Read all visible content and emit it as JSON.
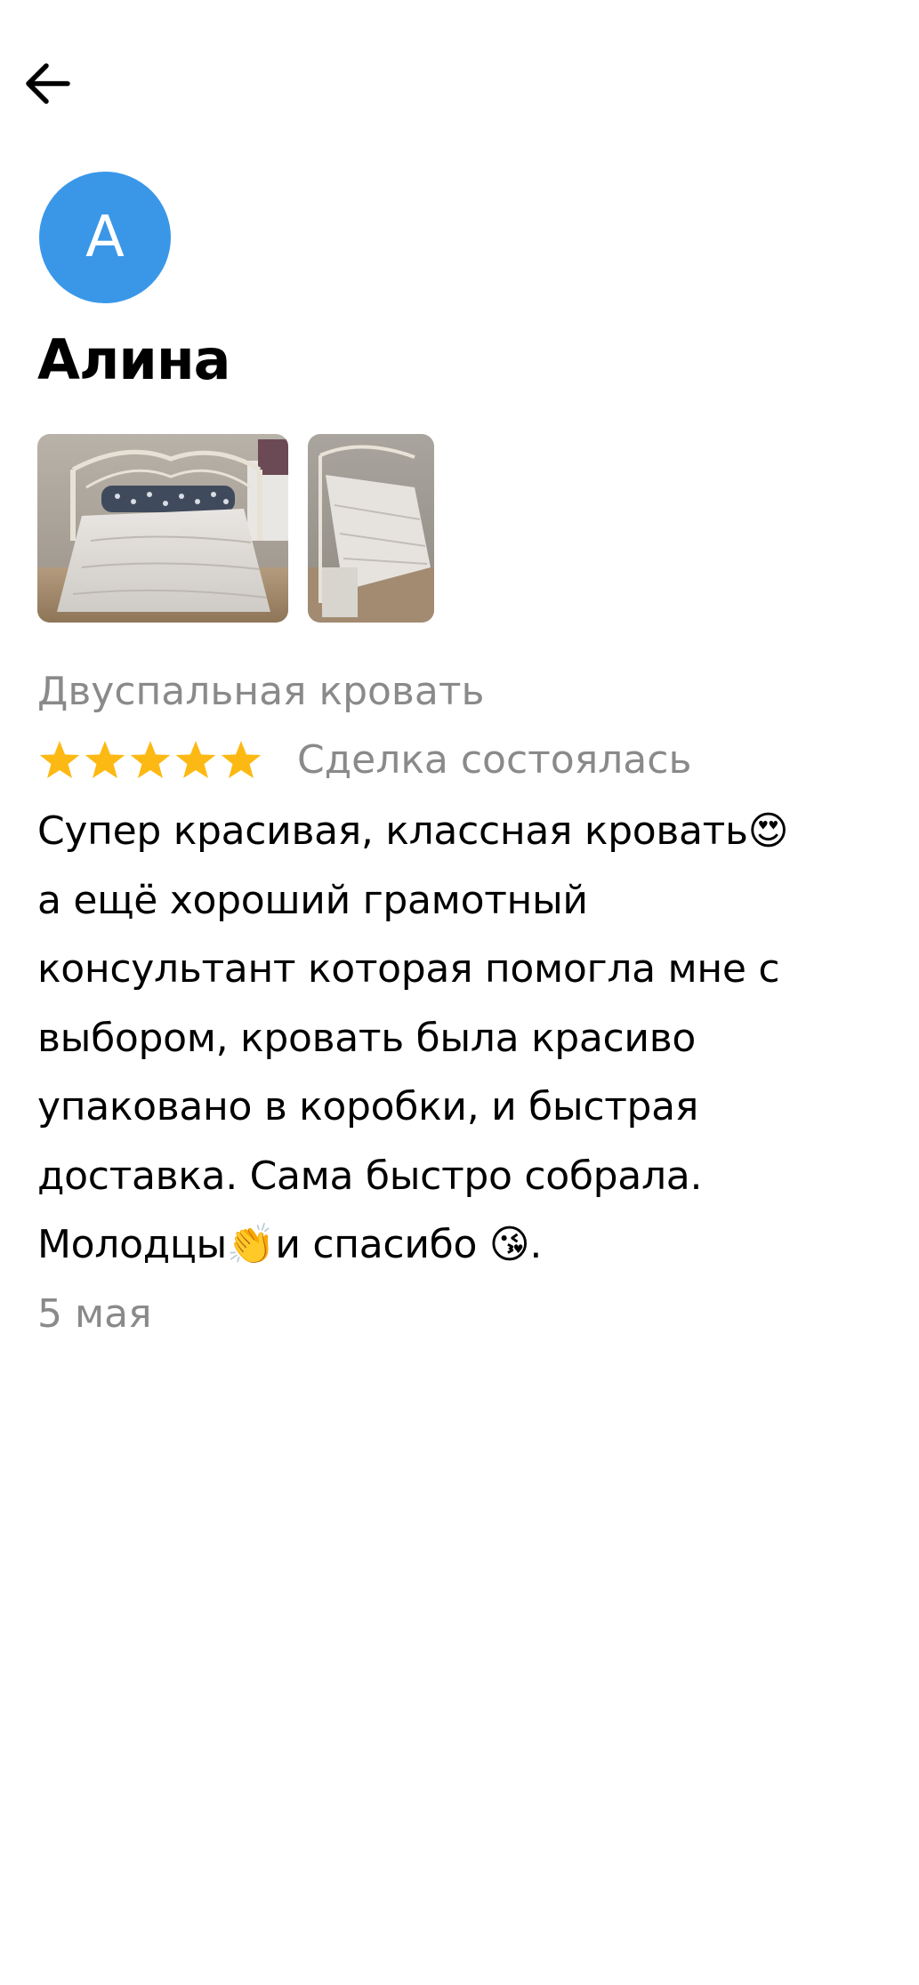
{
  "header": {
    "back_icon": "arrow-left-icon"
  },
  "author": {
    "initial": "А",
    "name": "Алина",
    "avatar_color": "#3a97e8"
  },
  "photos": [
    {
      "description": "bed-photo-1"
    },
    {
      "description": "bed-photo-2"
    }
  ],
  "review": {
    "product": "Двуспальная кровать",
    "rating": 5,
    "rating_max": 5,
    "star_color": "#fdb913",
    "deal_status": "Сделка состоялась",
    "text": "Супер красивая, классная кровать😍\nа ещё хороший грамотный\nконсультант которая помогла мне с\nвыбором, кровать была красиво\nупаковано в коробки, и быстрая\nдоставка. Сама быстро собрала.\nМолодцы👏и спасибо 😘.",
    "date": "5 мая"
  }
}
